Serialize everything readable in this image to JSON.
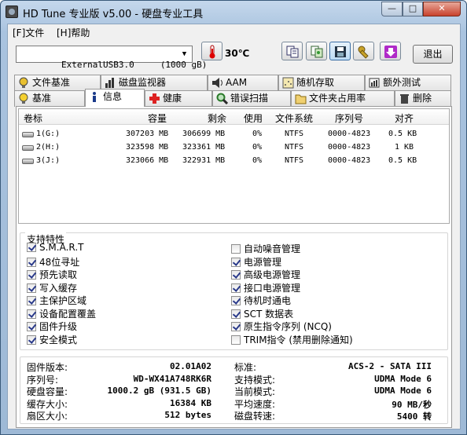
{
  "window": {
    "title": "HD Tune 专业版 v5.00 - 硬盘专业工具",
    "min": "—",
    "max": "□",
    "close": "✕"
  },
  "menu": {
    "file": "[F]文件",
    "help": "[H]帮助"
  },
  "toolbar": {
    "drive": "ExternalUSB3.0     (1000 gB)",
    "temperature": "30℃",
    "exit": "退出"
  },
  "tabs_top": [
    "文件基准",
    "磁盘监视器",
    "AAM",
    "随机存取",
    "额外测试"
  ],
  "tabs_bottom": [
    "基准",
    "信息",
    "健康",
    "错误扫描",
    "文件夹占用率",
    "删除"
  ],
  "active_tab": "信息",
  "volumes": {
    "headers": [
      "卷标",
      "容量",
      "剩余",
      "使用",
      "文件系统",
      "序列号",
      "对齐"
    ],
    "rows": [
      [
        "1(G:)",
        "307203 MB",
        "306699 MB",
        "0%",
        "NTFS",
        "0000-4823",
        "0.5 KB"
      ],
      [
        "2(H:)",
        "323598 MB",
        "323361 MB",
        "0%",
        "NTFS",
        "0000-4823",
        "1 KB"
      ],
      [
        "3(J:)",
        "323066 MB",
        "322931 MB",
        "0%",
        "NTFS",
        "0000-4823",
        "0.5 KB"
      ]
    ]
  },
  "features": {
    "title": "支持特性",
    "left": [
      {
        "label": "S.M.A.R.T",
        "checked": true
      },
      {
        "label": "48位寻址",
        "checked": true
      },
      {
        "label": "预先读取",
        "checked": true
      },
      {
        "label": "写入缓存",
        "checked": true
      },
      {
        "label": "主保护区域",
        "checked": true
      },
      {
        "label": "设备配置覆盖",
        "checked": true
      },
      {
        "label": "固件升级",
        "checked": true
      },
      {
        "label": "安全模式",
        "checked": true
      }
    ],
    "right": [
      {
        "label": "自动噪音管理",
        "checked": false
      },
      {
        "label": "电源管理",
        "checked": true
      },
      {
        "label": "高级电源管理",
        "checked": true
      },
      {
        "label": "接口电源管理",
        "checked": true
      },
      {
        "label": "待机时通电",
        "checked": true
      },
      {
        "label": "SCT 数据表",
        "checked": true
      },
      {
        "label": "原生指令序列 (NCQ)",
        "checked": true
      },
      {
        "label": "TRIM指令 (禁用删除通知)",
        "checked": false
      }
    ]
  },
  "details": {
    "left": [
      {
        "label": "固件版本:",
        "value": "02.01A02"
      },
      {
        "label": "序列号:",
        "value": "WD-WX41A748RK6R"
      },
      {
        "label": "硬盘容量:",
        "value": "1000.2 gB (931.5 GB)"
      },
      {
        "label": "缓存大小:",
        "value": "16384 KB"
      },
      {
        "label": "扇区大小:",
        "value": "512 bytes"
      }
    ],
    "right": [
      {
        "label": "标准:",
        "value": "ACS-2 - SATA III"
      },
      {
        "label": "支持模式:",
        "value": "UDMA Mode 6"
      },
      {
        "label": "当前模式:",
        "value": "UDMA Mode 6"
      },
      {
        "label": "平均速度:",
        "value": "90 MB/秒"
      },
      {
        "label": "磁盘转速:",
        "value": "5400 转"
      }
    ]
  }
}
